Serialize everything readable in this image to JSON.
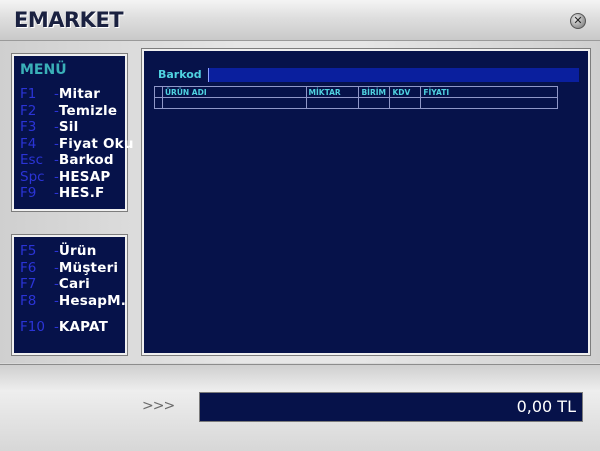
{
  "app": {
    "title": "EMARKET"
  },
  "menu1": {
    "title": "MENÜ",
    "items": [
      {
        "key": "F1",
        "label": "Mitar"
      },
      {
        "key": "F2",
        "label": "Temizle"
      },
      {
        "key": "F3",
        "label": "Sil"
      },
      {
        "key": "F4",
        "label": "Fiyat Oku"
      },
      {
        "key": "Esc",
        "label": "Barkod"
      },
      {
        "key": "Spc",
        "label": "HESAP"
      },
      {
        "key": "F9",
        "label": "HES.F"
      }
    ]
  },
  "menu2": {
    "items": [
      {
        "key": "F5",
        "label": "Ürün"
      },
      {
        "key": "F6",
        "label": "Müşteri"
      },
      {
        "key": "F7",
        "label": "Cari"
      },
      {
        "key": "F8",
        "label": "HesapM."
      },
      {
        "key": "F10",
        "label": "KAPAT"
      }
    ]
  },
  "content": {
    "tab_label": "Barkod",
    "columns": [
      "ÜRÜN ADI",
      "MİKTAR",
      "BİRİM",
      "KDV",
      "FİYATI"
    ]
  },
  "footer": {
    "arrows": ">>>",
    "total": "0,00 TL"
  },
  "colors": {
    "panel_bg": "#06124a",
    "key_blue": "#2b34d6",
    "accent_cyan": "#4fd2e0"
  }
}
